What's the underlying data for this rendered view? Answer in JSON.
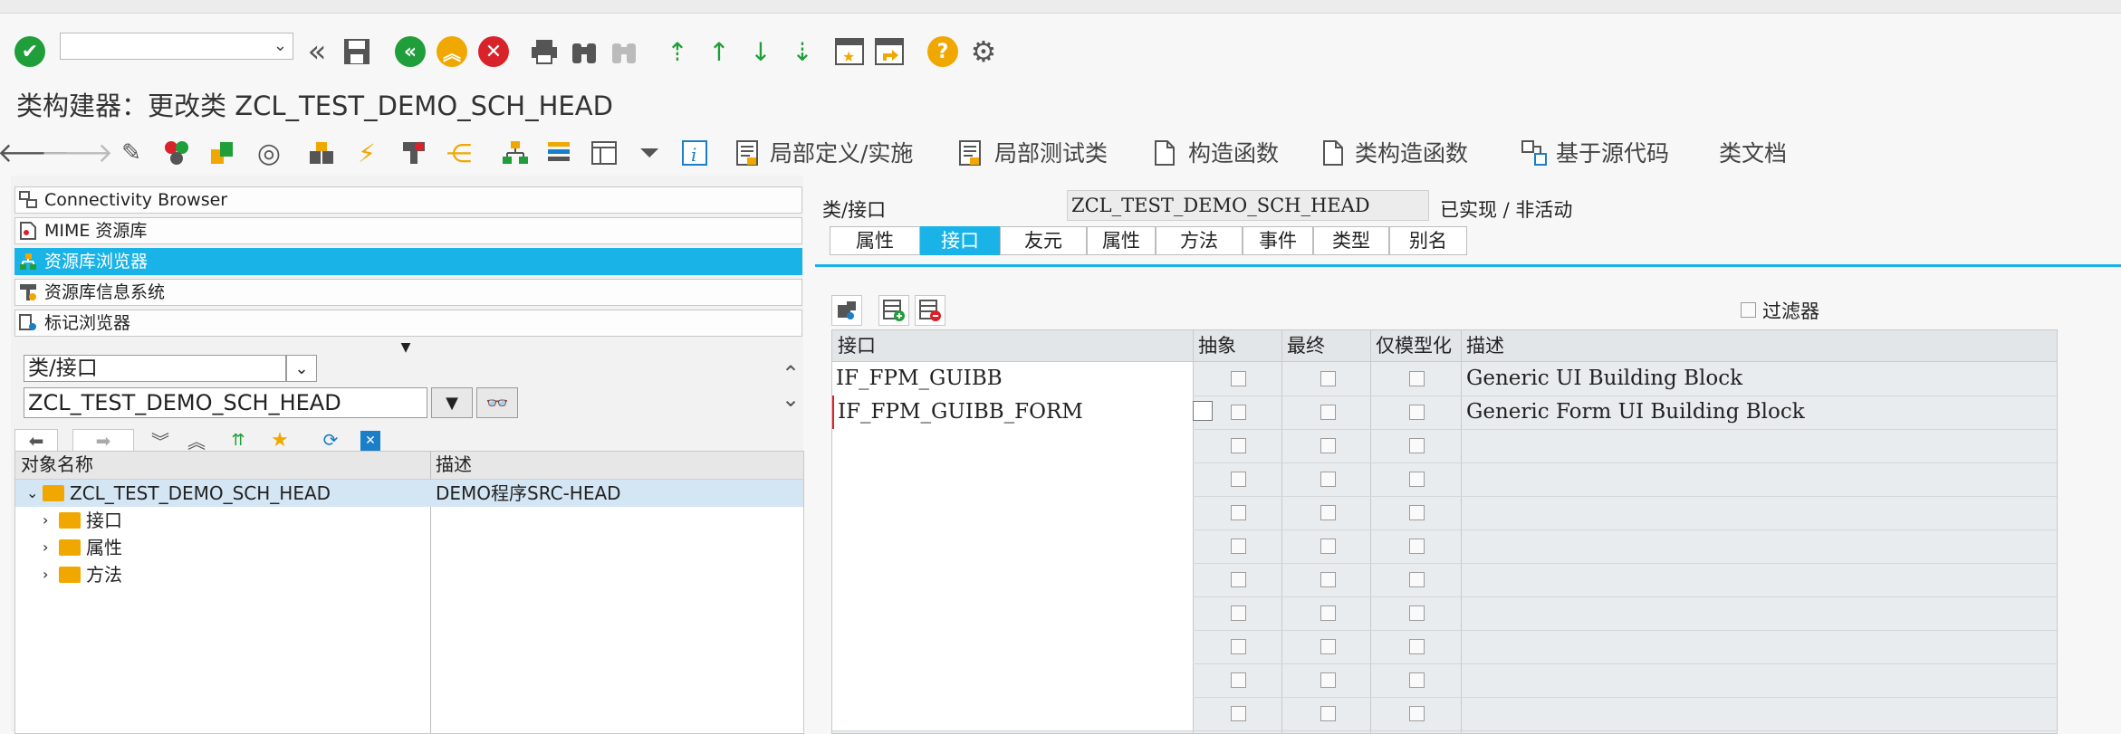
{
  "toolbar": {
    "command_field_value": "",
    "icons": [
      "check-icon",
      "double-left-icon",
      "save-icon",
      "back-icon",
      "exit-icon",
      "cancel-icon",
      "print-icon",
      "find-icon",
      "find-next-icon",
      "first-page-icon",
      "prev-page-icon",
      "next-page-icon",
      "last-page-icon",
      "new-session-icon",
      "shortcut-icon",
      "help-icon",
      "settings-icon"
    ]
  },
  "title": "类构建器：更改类 ZCL_TEST_DEMO_SCH_HEAD",
  "app_toolbar": {
    "local_defs": "局部定义/实施",
    "local_tests": "局部测试类",
    "constructor": "构造函数",
    "class_constructor": "类构造函数",
    "source_based": "基于源代码",
    "class_doc": "类文档"
  },
  "navigator": {
    "bars": [
      {
        "label": "Connectivity Browser",
        "icon": "connectivity-icon"
      },
      {
        "label": "MIME 资源库",
        "icon": "mime-icon"
      },
      {
        "label": "资源库浏览器",
        "icon": "repository-browser-icon"
      },
      {
        "label": "资源库信息系统",
        "icon": "info-system-icon"
      },
      {
        "label": "标记浏览器",
        "icon": "tag-browser-icon"
      }
    ],
    "object_type": "类/接口",
    "object_name": "ZCL_TEST_DEMO_SCH_HEAD",
    "tree_headers": {
      "name": "对象名称",
      "desc": "描述"
    },
    "tree": {
      "root_name": "ZCL_TEST_DEMO_SCH_HEAD",
      "root_desc": "DEMO程序SRC-HEAD",
      "children": [
        "接口",
        "属性",
        "方法"
      ]
    }
  },
  "editor": {
    "class_label": "类/接口",
    "class_value": "ZCL_TEST_DEMO_SCH_HEAD",
    "status": "已实现 / 非活动",
    "tabs": [
      "属性",
      "接口",
      "友元",
      "属性",
      "方法",
      "事件",
      "类型",
      "别名"
    ],
    "active_tab": 1,
    "filter_label": "过滤器",
    "columns": [
      "接口",
      "抽象",
      "最终",
      "仅模型化",
      "描述"
    ],
    "rows": [
      {
        "interface": "IF_FPM_GUIBB",
        "desc": "Generic UI Building Block"
      },
      {
        "interface": "IF_FPM_GUIBB_FORM",
        "desc": "Generic Form UI Building Block"
      },
      {
        "interface": "",
        "desc": ""
      },
      {
        "interface": "",
        "desc": ""
      },
      {
        "interface": "",
        "desc": ""
      },
      {
        "interface": "",
        "desc": ""
      },
      {
        "interface": "",
        "desc": ""
      },
      {
        "interface": "",
        "desc": ""
      },
      {
        "interface": "",
        "desc": ""
      },
      {
        "interface": "",
        "desc": ""
      },
      {
        "interface": "",
        "desc": ""
      }
    ]
  },
  "colors": {
    "accent": "#1ab3e8",
    "ok_green": "#1f9e3a",
    "cancel_red": "#d8232a",
    "help_orange": "#f0a800"
  }
}
